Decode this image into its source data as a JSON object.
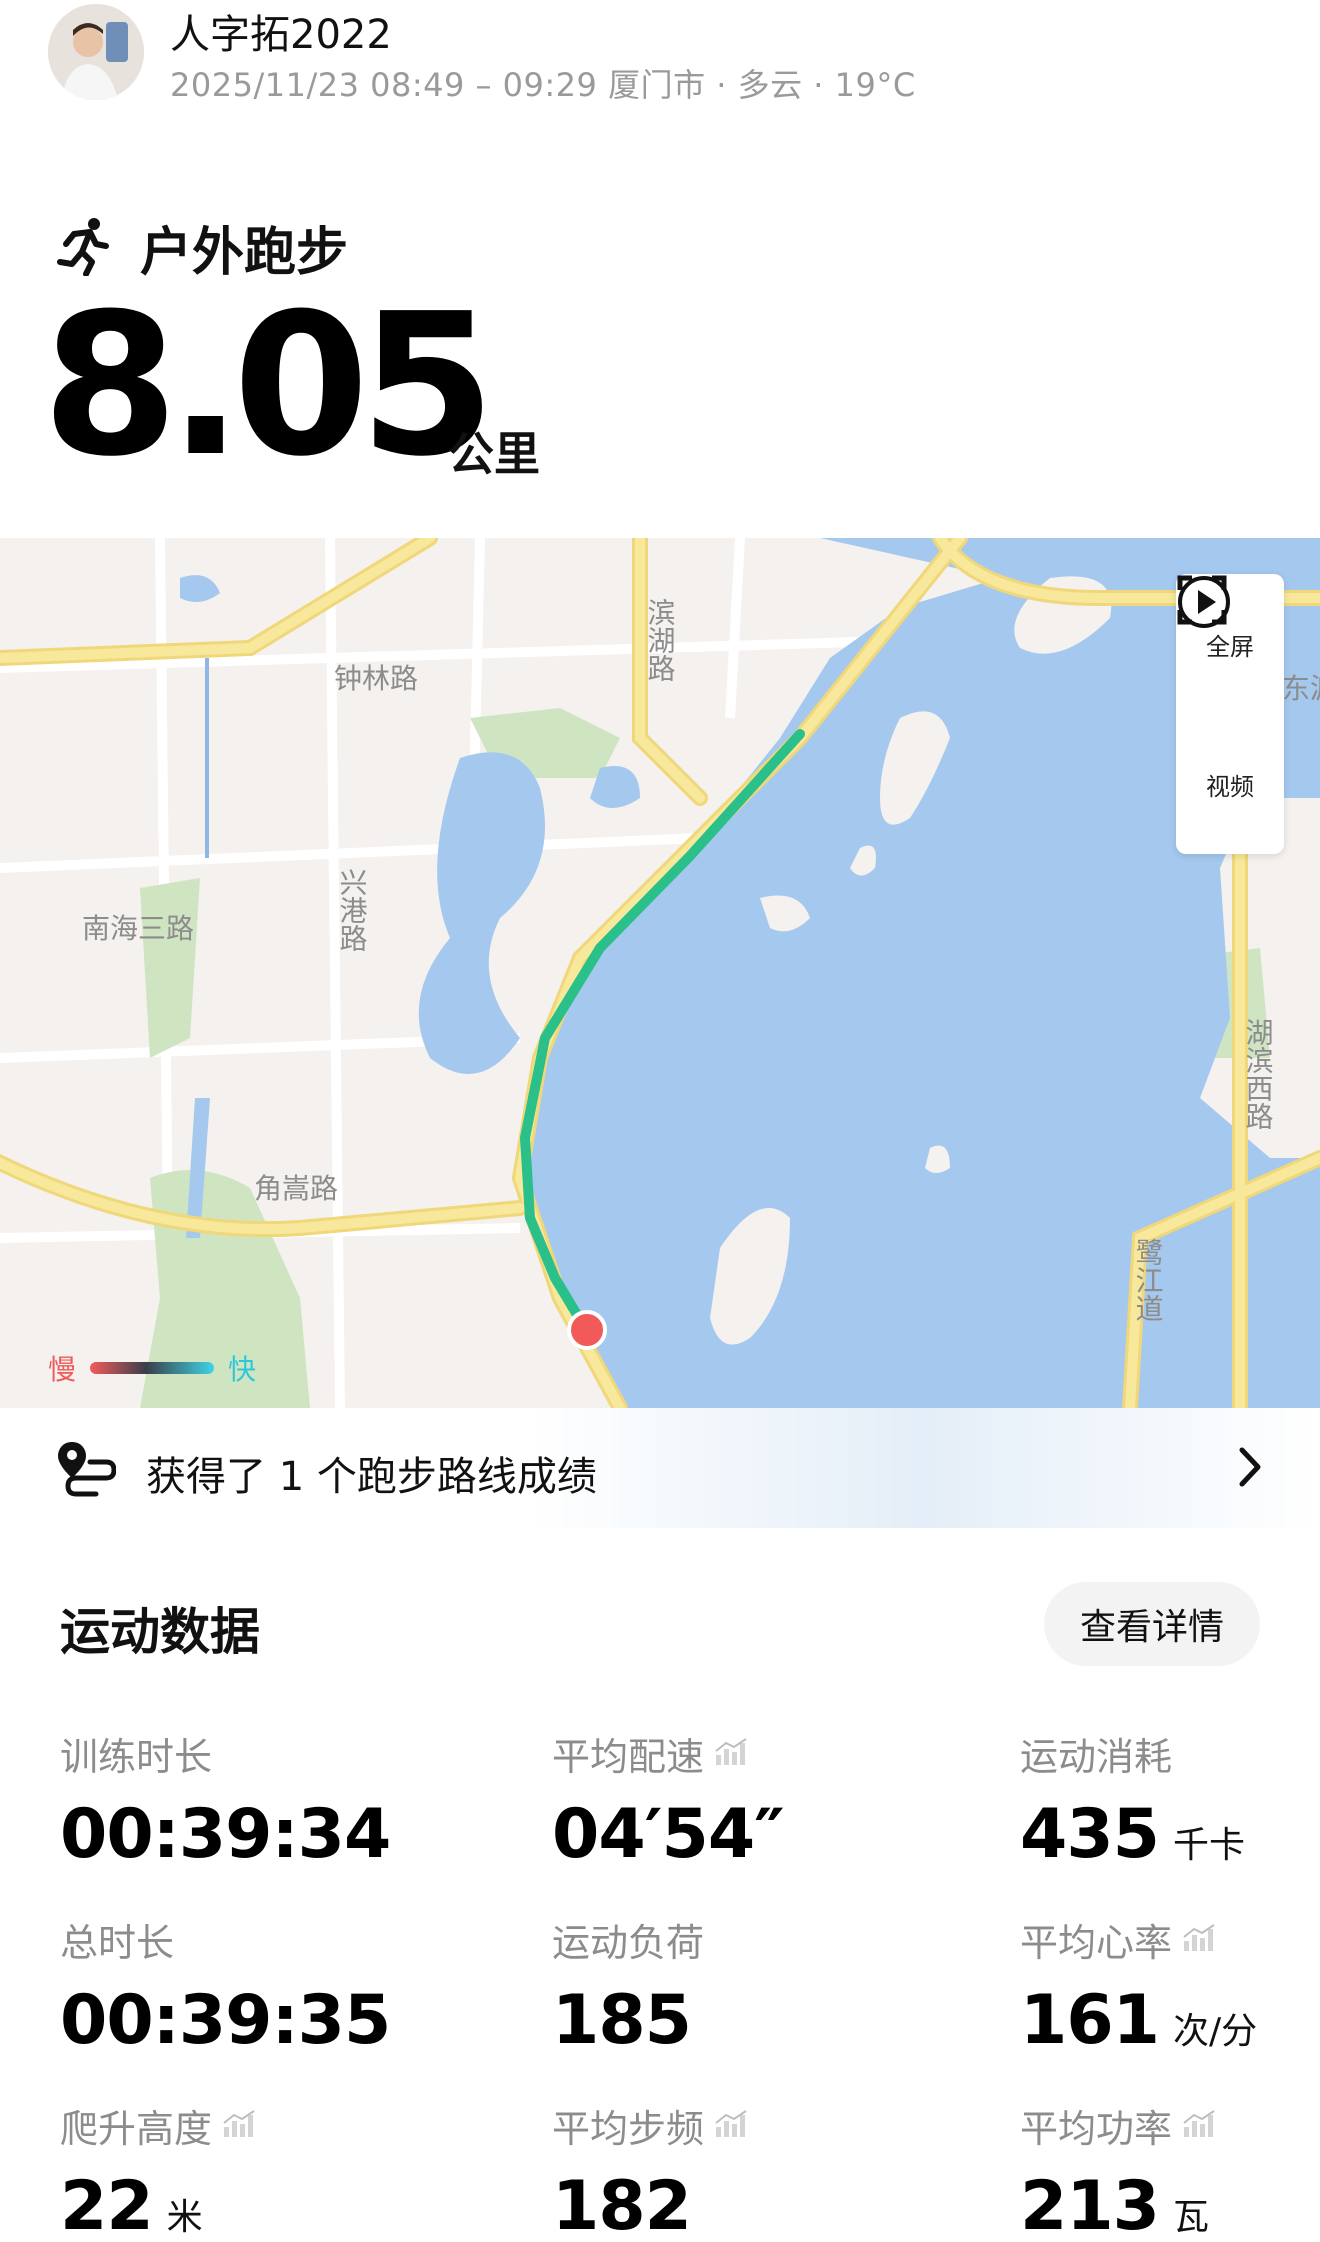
{
  "header": {
    "user_name": "人字拓2022",
    "meta": "2025/11/23 08:49 – 09:29 厦门市 · 多云 · 19°C"
  },
  "activity": {
    "type_label": "户外跑步",
    "type_icon": "running-person-icon",
    "distance": "8.05",
    "distance_unit": "公里"
  },
  "map": {
    "place_labels": [
      "钟林路",
      "滨湖路",
      "南海三路",
      "兴港路",
      "角嵩路",
      "湖滨西路",
      "鹭江道",
      "东渡"
    ],
    "tools": {
      "fullscreen_label": "全屏",
      "video_label": "视频"
    },
    "legend": {
      "slow": "慢",
      "fast": "快"
    },
    "colors": {
      "water": "#a5c8ef",
      "road": "#f7e38e",
      "green": "#cfe5c2",
      "route": "#2bbf8a",
      "end_marker": "#f25a5a"
    }
  },
  "achievement": {
    "text": "获得了 1 个跑步路线成绩",
    "icon": "route-pin-icon"
  },
  "stats_section": {
    "title": "运动数据",
    "details_button": "查看详情",
    "items": [
      {
        "label": "训练时长",
        "value": "00:39:34",
        "unit": "",
        "has_chart_icon": false
      },
      {
        "label": "平均配速",
        "value": "04′54″",
        "unit": "",
        "has_chart_icon": true
      },
      {
        "label": "运动消耗",
        "value": "435",
        "unit": "千卡",
        "has_chart_icon": false
      },
      {
        "label": "总时长",
        "value": "00:39:35",
        "unit": "",
        "has_chart_icon": false
      },
      {
        "label": "运动负荷",
        "value": "185",
        "unit": "",
        "has_chart_icon": false
      },
      {
        "label": "平均心率",
        "value": "161",
        "unit": "次/分",
        "has_chart_icon": true
      },
      {
        "label": "爬升高度",
        "value": "22",
        "unit": "米",
        "has_chart_icon": true
      },
      {
        "label": "平均步频",
        "value": "182",
        "unit": "",
        "has_chart_icon": true
      },
      {
        "label": "平均功率",
        "value": "213",
        "unit": "瓦",
        "has_chart_icon": true
      }
    ]
  }
}
